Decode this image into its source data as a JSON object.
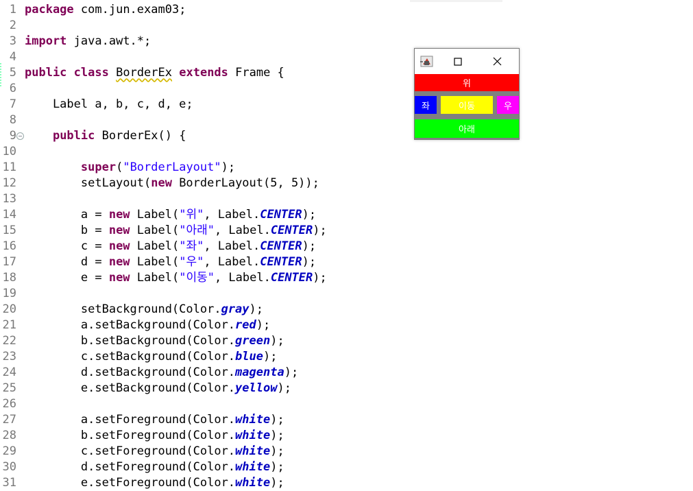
{
  "editor": {
    "lines": [
      {
        "n": "1",
        "t": [
          [
            "kw",
            "package"
          ],
          [
            "",
            "com.jun.exam03;"
          ]
        ]
      },
      {
        "n": "2",
        "t": []
      },
      {
        "n": "3",
        "t": [
          [
            "kw",
            "import"
          ],
          [
            "",
            "java.awt.*;"
          ]
        ]
      },
      {
        "n": "4",
        "t": []
      },
      {
        "n": "5",
        "t": [
          [
            "kw",
            "public"
          ],
          [
            "",
            ""
          ],
          [
            "kw",
            "class"
          ],
          [
            "",
            ""
          ],
          [
            "warn",
            "BorderEx"
          ],
          [
            "",
            ""
          ],
          [
            "kw",
            "extends"
          ],
          [
            "",
            " Frame {"
          ]
        ]
      },
      {
        "n": "6",
        "t": []
      },
      {
        "n": "7",
        "t": [
          [
            "",
            "    Label a, b, c, d, e;"
          ]
        ]
      },
      {
        "n": "8",
        "t": []
      },
      {
        "n": "9",
        "t": [
          [
            "",
            "    "
          ],
          [
            "kw",
            "public"
          ],
          [
            "",
            " BorderEx() {"
          ]
        ]
      },
      {
        "n": "10",
        "t": []
      },
      {
        "n": "11",
        "t": [
          [
            "",
            "        "
          ],
          [
            "kw",
            "super"
          ],
          [
            "",
            "("
          ],
          [
            "str",
            "\"BorderLayout\""
          ],
          [
            "",
            ");"
          ]
        ]
      },
      {
        "n": "12",
        "t": [
          [
            "",
            "        setLayout("
          ],
          [
            "kw",
            "new"
          ],
          [
            "",
            " BorderLayout(5, 5));"
          ]
        ]
      },
      {
        "n": "13",
        "t": []
      },
      {
        "n": "14",
        "t": [
          [
            "",
            "        a = "
          ],
          [
            "kw",
            "new"
          ],
          [
            "",
            " Label("
          ],
          [
            "str",
            "\"위\""
          ],
          [
            "",
            ", Label."
          ],
          [
            "fld",
            "CENTER"
          ],
          [
            "",
            ");"
          ]
        ]
      },
      {
        "n": "15",
        "t": [
          [
            "",
            "        b = "
          ],
          [
            "kw",
            "new"
          ],
          [
            "",
            " Label("
          ],
          [
            "str",
            "\"아래\""
          ],
          [
            "",
            ", Label."
          ],
          [
            "fld",
            "CENTER"
          ],
          [
            "",
            ");"
          ]
        ]
      },
      {
        "n": "16",
        "t": [
          [
            "",
            "        c = "
          ],
          [
            "kw",
            "new"
          ],
          [
            "",
            " Label("
          ],
          [
            "str",
            "\"좌\""
          ],
          [
            "",
            ", Label."
          ],
          [
            "fld",
            "CENTER"
          ],
          [
            "",
            ");"
          ]
        ]
      },
      {
        "n": "17",
        "t": [
          [
            "",
            "        d = "
          ],
          [
            "kw",
            "new"
          ],
          [
            "",
            " Label("
          ],
          [
            "str",
            "\"우\""
          ],
          [
            "",
            ", Label."
          ],
          [
            "fld",
            "CENTER"
          ],
          [
            "",
            ");"
          ]
        ]
      },
      {
        "n": "18",
        "t": [
          [
            "",
            "        e = "
          ],
          [
            "kw",
            "new"
          ],
          [
            "",
            " Label("
          ],
          [
            "str",
            "\"이동\""
          ],
          [
            "",
            ", Label."
          ],
          [
            "fld",
            "CENTER"
          ],
          [
            "",
            ");"
          ]
        ]
      },
      {
        "n": "19",
        "t": []
      },
      {
        "n": "20",
        "t": [
          [
            "",
            "        setBackground(Color."
          ],
          [
            "fld",
            "gray"
          ],
          [
            "",
            ");"
          ]
        ]
      },
      {
        "n": "21",
        "t": [
          [
            "",
            "        a.setBackground(Color."
          ],
          [
            "fld",
            "red"
          ],
          [
            "",
            ");"
          ]
        ]
      },
      {
        "n": "22",
        "t": [
          [
            "",
            "        b.setBackground(Color."
          ],
          [
            "fld",
            "green"
          ],
          [
            "",
            ");"
          ]
        ]
      },
      {
        "n": "23",
        "t": [
          [
            "",
            "        c.setBackground(Color."
          ],
          [
            "fld",
            "blue"
          ],
          [
            "",
            ");"
          ]
        ]
      },
      {
        "n": "24",
        "t": [
          [
            "",
            "        d.setBackground(Color."
          ],
          [
            "fld",
            "magenta"
          ],
          [
            "",
            ");"
          ]
        ]
      },
      {
        "n": "25",
        "t": [
          [
            "",
            "        e.setBackground(Color."
          ],
          [
            "fld",
            "yellow"
          ],
          [
            "",
            ");"
          ]
        ]
      },
      {
        "n": "26",
        "t": []
      },
      {
        "n": "27",
        "t": [
          [
            "",
            "        a.setForeground(Color."
          ],
          [
            "fld",
            "white"
          ],
          [
            "",
            ");"
          ]
        ]
      },
      {
        "n": "28",
        "t": [
          [
            "",
            "        b.setForeground(Color."
          ],
          [
            "fld",
            "white"
          ],
          [
            "",
            ");"
          ]
        ]
      },
      {
        "n": "29",
        "t": [
          [
            "",
            "        c.setForeground(Color."
          ],
          [
            "fld",
            "white"
          ],
          [
            "",
            ");"
          ]
        ]
      },
      {
        "n": "30",
        "t": [
          [
            "",
            "        d.setForeground(Color."
          ],
          [
            "fld",
            "white"
          ],
          [
            "",
            ");"
          ]
        ]
      },
      {
        "n": "31",
        "t": [
          [
            "",
            "        e.setForeground(Color."
          ],
          [
            "fld",
            "white"
          ],
          [
            "",
            ");"
          ]
        ]
      }
    ]
  },
  "frame": {
    "north": "위",
    "west": "좌",
    "center": "이동",
    "east": "우",
    "south": "아래",
    "colors": {
      "bg": "#808080",
      "north": "#ff0000",
      "west": "#0000ff",
      "center": "#ffff00",
      "east": "#ff00ff",
      "south": "#00ff00"
    }
  }
}
